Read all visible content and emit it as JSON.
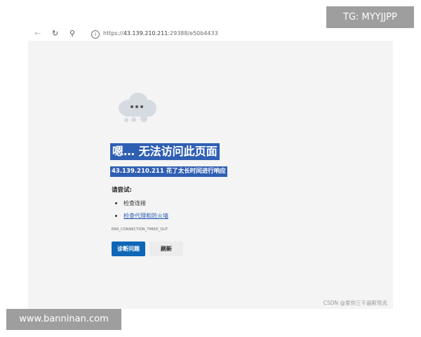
{
  "browser": {
    "url_prefix": "https://",
    "url_host": "43.139.210.211",
    "url_rest": ":29388/e50b4433",
    "icons": {
      "back": "arrow-left-icon",
      "reload": "reload-icon",
      "search": "search-icon",
      "info": "info-icon"
    }
  },
  "error_page": {
    "title": "嗯… 无法访问此页面",
    "subtitle": "43.139.210.211 花了太长时间进行响应",
    "try_label": "请尝试:",
    "suggestions": [
      "检查连接",
      "检查代理和防火墙"
    ],
    "error_code": "ERR_CONNECTION_TIMED_OUT",
    "diagnose_button": "诊断问题",
    "refresh_button": "刷新",
    "icon": "cloud-icon"
  },
  "watermarks": {
    "csdn": "CSDN @爱你三千遍斯塔克",
    "telegram": "TG: MYYJJPP",
    "site": "www.banninan.com"
  },
  "colors": {
    "highlight": "#2f5fb3",
    "primary_button": "#0f66b7",
    "page_bg": "#f4f4f4",
    "watermark_bg": "#9e9e9e"
  }
}
